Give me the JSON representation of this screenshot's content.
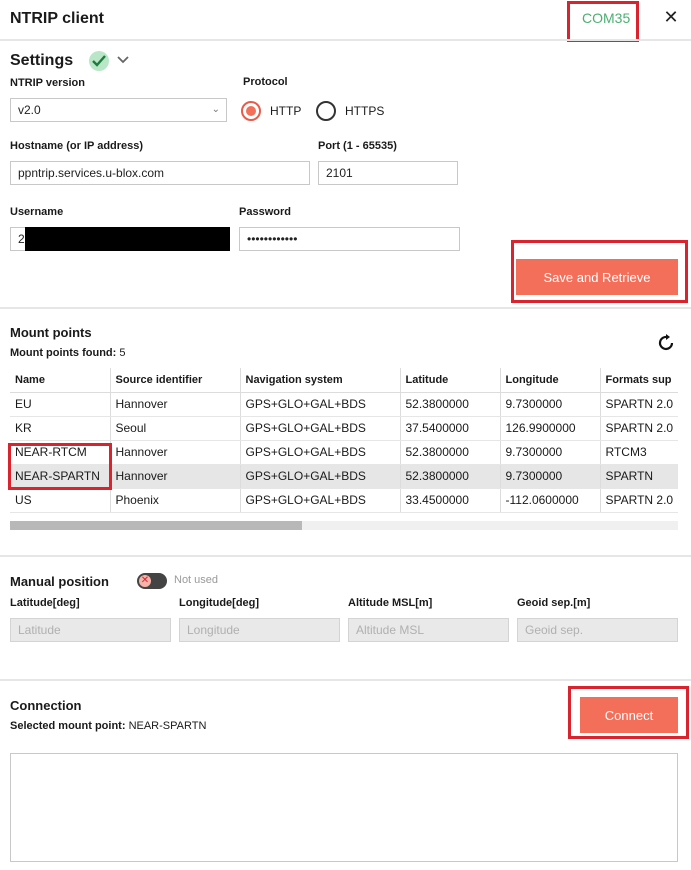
{
  "header": {
    "title": "NTRIP client",
    "port": "COM35",
    "close_icon": "close-icon"
  },
  "settings": {
    "title": "Settings",
    "status": "check-icon",
    "version_label": "NTRIP version",
    "version_value": "v2.0",
    "protocol_label": "Protocol",
    "protocol_options": [
      "HTTP",
      "HTTPS"
    ],
    "protocol_selected": "HTTP",
    "hostname_label": "Hostname (or IP address)",
    "hostname_value": "ppntrip.services.u-blox.com",
    "port_label": "Port (1 - 65535)",
    "port_value": "2101",
    "username_label": "Username",
    "username_value": "2",
    "password_label": "Password",
    "password_value": "••••••••••••",
    "save_button": "Save and Retrieve"
  },
  "mount_points": {
    "title": "Mount points",
    "found_label": "Mount points found:",
    "found_count": "5",
    "columns": [
      "Name",
      "Source identifier",
      "Navigation system",
      "Latitude",
      "Longitude",
      "Formats sup"
    ],
    "rows": [
      [
        "EU",
        "Hannover",
        "GPS+GLO+GAL+BDS",
        "52.3800000",
        "9.7300000",
        "SPARTN 2.0"
      ],
      [
        "KR",
        "Seoul",
        "GPS+GLO+GAL+BDS",
        "37.5400000",
        "126.9900000",
        "SPARTN 2.0"
      ],
      [
        "NEAR-RTCM",
        "Hannover",
        "GPS+GLO+GAL+BDS",
        "52.3800000",
        "9.7300000",
        "RTCM3"
      ],
      [
        "NEAR-SPARTN",
        "Hannover",
        "GPS+GLO+GAL+BDS",
        "52.3800000",
        "9.7300000",
        "SPARTN"
      ],
      [
        "US",
        "Phoenix",
        "GPS+GLO+GAL+BDS",
        "33.4500000",
        "-112.0600000",
        "SPARTN 2.0"
      ]
    ],
    "selected_row": 3
  },
  "manual_position": {
    "title": "Manual position",
    "toggle_state": "Not used",
    "fields": [
      {
        "label": "Latitude[deg]",
        "placeholder": "Latitude"
      },
      {
        "label": "Longitude[deg]",
        "placeholder": "Longitude"
      },
      {
        "label": "Altitude MSL[m]",
        "placeholder": "Altitude MSL"
      },
      {
        "label": "Geoid sep.[m]",
        "placeholder": "Geoid sep."
      }
    ]
  },
  "connection": {
    "title": "Connection",
    "selected_label": "Selected mount point:",
    "selected_value": "NEAR-SPARTN",
    "connect_button": "Connect",
    "log_text": ""
  },
  "colors": {
    "accent": "#f36f5a",
    "highlight": "#d9232e",
    "status_green": "#4caf72"
  }
}
